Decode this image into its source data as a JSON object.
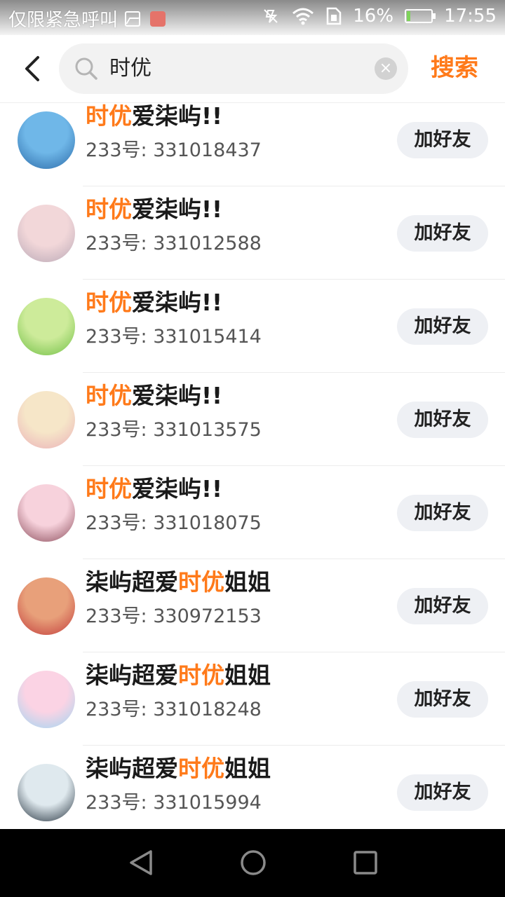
{
  "status_bar": {
    "carrier": "仅限紧急呼叫",
    "battery": "16%",
    "battery_level": 0.16,
    "time": "17:55",
    "icons": [
      "image-icon",
      "app-notification-icon",
      "mute-icon",
      "wifi-icon",
      "sim-icon",
      "battery-icon"
    ]
  },
  "header": {
    "search_value": "时优",
    "search_button": "搜索",
    "icons": [
      "back-icon",
      "search-icon",
      "clear-icon"
    ]
  },
  "results": [
    {
      "pre": "",
      "hl": "时优",
      "post": "爱柒屿!!",
      "uid": "233号: 331018437",
      "button": "加好友",
      "avatar_colors": [
        "#6fb7e8",
        "#2b6aa8"
      ]
    },
    {
      "pre": "",
      "hl": "时优",
      "post": "爱柒屿!!",
      "uid": "233号: 331012588",
      "button": "加好友",
      "avatar_colors": [
        "#f2d7d9",
        "#b9a8b6"
      ]
    },
    {
      "pre": "",
      "hl": "时优",
      "post": "爱柒屿!!",
      "uid": "233号: 331015414",
      "button": "加好友",
      "avatar_colors": [
        "#cdeb9a",
        "#6fbf44"
      ]
    },
    {
      "pre": "",
      "hl": "时优",
      "post": "爱柒屿!!",
      "uid": "233号: 331013575",
      "button": "加好友",
      "avatar_colors": [
        "#f6e6c8",
        "#eab0b8"
      ]
    },
    {
      "pre": "",
      "hl": "时优",
      "post": "爱柒屿!!",
      "uid": "233号: 331018075",
      "button": "加好友",
      "avatar_colors": [
        "#f7d2dc",
        "#8a4b5a"
      ]
    },
    {
      "pre": "柒屿超爱",
      "hl": "时优",
      "post": "姐姐",
      "uid": "233号: 330972153",
      "button": "加好友",
      "avatar_colors": [
        "#e8a07a",
        "#c23b3b"
      ]
    },
    {
      "pre": "柒屿超爱",
      "hl": "时优",
      "post": "姐姐",
      "uid": "233号: 331018248",
      "button": "加好友",
      "avatar_colors": [
        "#fbd3e4",
        "#9fd6f2"
      ]
    },
    {
      "pre": "柒屿超爱",
      "hl": "时优",
      "post": "姐姐",
      "uid": "233号: 331015994",
      "button": "加好友",
      "avatar_colors": [
        "#dfe9ee",
        "#24313d"
      ]
    }
  ],
  "nav_bar": {
    "icons": [
      "nav-back-icon",
      "nav-home-icon",
      "nav-recent-icon"
    ]
  },
  "colors": {
    "accent": "#ff7a1a",
    "button_bg": "#eef0f4",
    "text": "#1a1a1a"
  }
}
